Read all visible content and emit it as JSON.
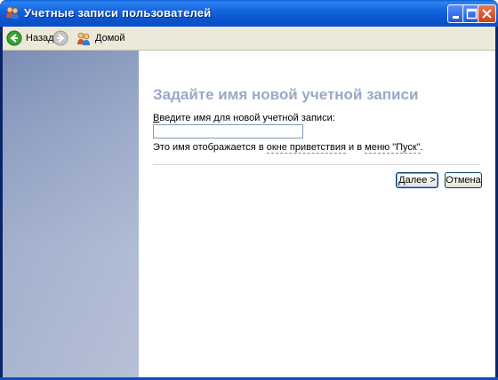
{
  "window": {
    "title": "Учетные записи пользователей",
    "icon": "users-icon"
  },
  "toolbar": {
    "back_label": "Назад",
    "home_label": "Домой"
  },
  "main": {
    "heading": "Задайте имя новой учетной записи",
    "field_label_prefix": "В",
    "field_label_rest": "ведите имя для новой учетной записи:",
    "input_value": "",
    "hint_part1": "Это имя отображается в ",
    "hint_link1": "окне приветствия",
    "hint_part2": " и в ",
    "hint_link2": "меню \"Пуск\"",
    "hint_part3": ".",
    "next_label": "Далее >",
    "cancel_label": "Отмена"
  },
  "colors": {
    "titlebar": "#0b55cf",
    "heading": "#9aa8c8",
    "sidebar": "#8e9fc2",
    "toolbar": "#ece9d8"
  }
}
